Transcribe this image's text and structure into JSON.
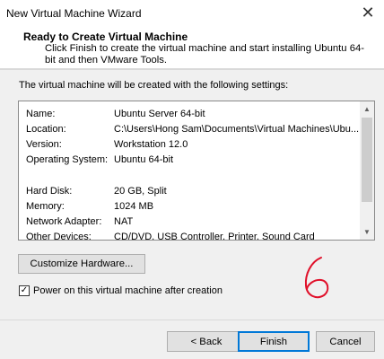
{
  "window": {
    "title": "New Virtual Machine Wizard",
    "close_glyph": "✕"
  },
  "header": {
    "title": "Ready to Create Virtual Machine",
    "description": "Click Finish to create the virtual machine and start installing Ubuntu 64-bit and then VMware Tools."
  },
  "intro": "The virtual machine will be created with the following settings:",
  "settings": {
    "group1": [
      {
        "key": "Name:",
        "value": "Ubuntu Server 64-bit"
      },
      {
        "key": "Location:",
        "value": "C:\\Users\\Hong Sam\\Documents\\Virtual Machines\\Ubu..."
      },
      {
        "key": "Version:",
        "value": "Workstation 12.0"
      },
      {
        "key": "Operating System:",
        "value": "Ubuntu 64-bit"
      }
    ],
    "group2": [
      {
        "key": "Hard Disk:",
        "value": "20 GB, Split"
      },
      {
        "key": "Memory:",
        "value": "1024 MB"
      },
      {
        "key": "Network Adapter:",
        "value": "NAT"
      },
      {
        "key": "Other Devices:",
        "value": "CD/DVD, USB Controller, Printer, Sound Card"
      }
    ]
  },
  "buttons": {
    "customize": "Customize Hardware...",
    "back": "< Back",
    "finish": "Finish",
    "cancel": "Cancel"
  },
  "power_on": {
    "label": "Power on this virtual machine after creation",
    "checked": true
  },
  "annotation": {
    "text": "6",
    "color": "#e0102a"
  },
  "colors": {
    "accent": "#0078d7"
  }
}
